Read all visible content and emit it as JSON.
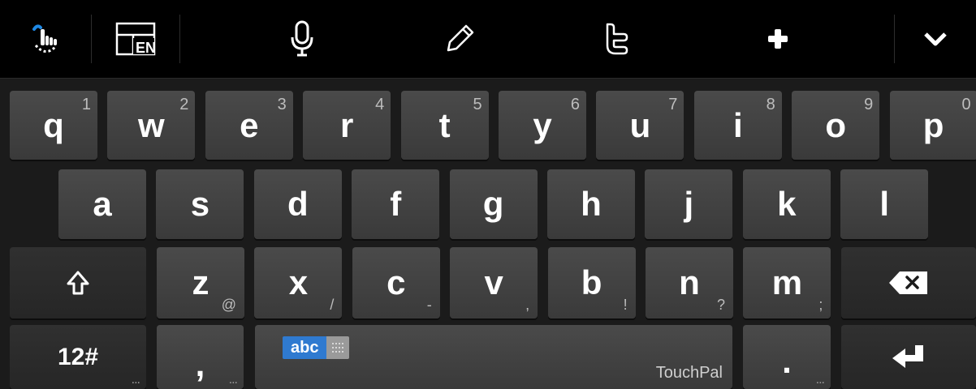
{
  "toolbar": {
    "icons": [
      "touch-gesture-icon",
      "layout-en-icon",
      "microphone-icon",
      "pencil-icon",
      "twitter-icon",
      "plus-icon",
      "chevron-down-icon"
    ],
    "layout_label": "EN",
    "accent": "#1e88e5"
  },
  "keyboard": {
    "row1": [
      {
        "char": "q",
        "hint": "1"
      },
      {
        "char": "w",
        "hint": "2"
      },
      {
        "char": "e",
        "hint": "3"
      },
      {
        "char": "r",
        "hint": "4"
      },
      {
        "char": "t",
        "hint": "5"
      },
      {
        "char": "y",
        "hint": "6"
      },
      {
        "char": "u",
        "hint": "7"
      },
      {
        "char": "i",
        "hint": "8"
      },
      {
        "char": "o",
        "hint": "9"
      },
      {
        "char": "p",
        "hint": "0"
      }
    ],
    "row2": [
      {
        "char": "a"
      },
      {
        "char": "s"
      },
      {
        "char": "d"
      },
      {
        "char": "f"
      },
      {
        "char": "g"
      },
      {
        "char": "h"
      },
      {
        "char": "j"
      },
      {
        "char": "k"
      },
      {
        "char": "l"
      }
    ],
    "row3": [
      {
        "char": "z",
        "sub": "@"
      },
      {
        "char": "x",
        "sub": "/"
      },
      {
        "char": "c",
        "sub": "-"
      },
      {
        "char": "v",
        "sub": ","
      },
      {
        "char": "b",
        "sub": "!"
      },
      {
        "char": "n",
        "sub": "?"
      },
      {
        "char": "m",
        "sub": ";"
      }
    ],
    "symbols_label": "12#",
    "comma_label": ",",
    "period_label": ".",
    "more_dots": "...",
    "space_mode": "abc",
    "space_brand": "TouchPal",
    "icons": {
      "shift": "shift-arrow-icon",
      "backspace": "backspace-icon",
      "enter": "enter-icon"
    }
  }
}
